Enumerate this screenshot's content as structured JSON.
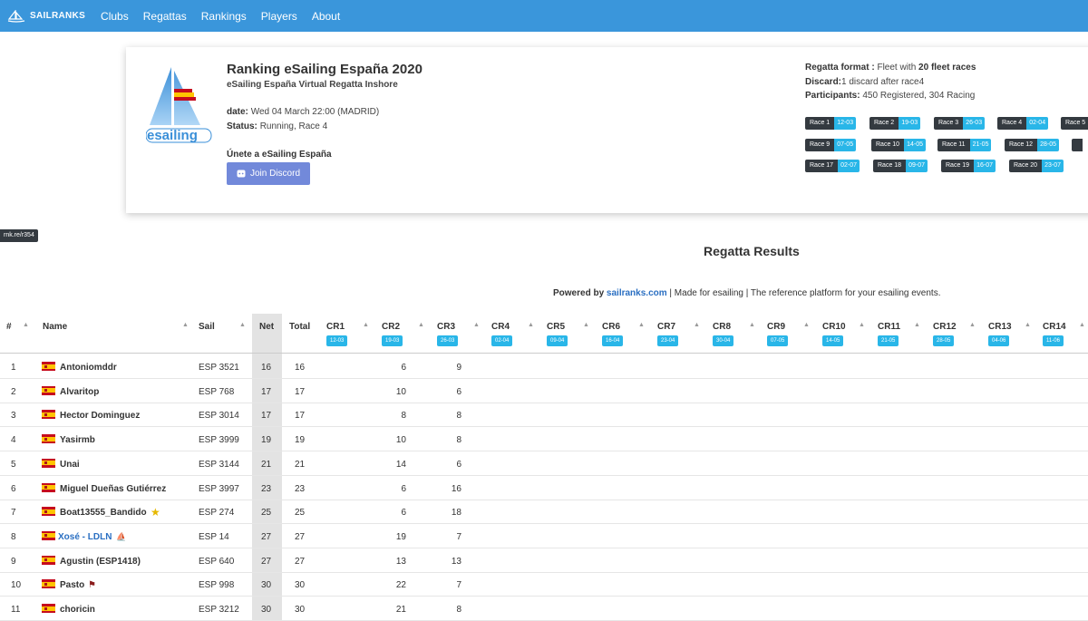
{
  "nav": {
    "brand": "SAILRANKS",
    "items": [
      "Clubs",
      "Regattas",
      "Rankings",
      "Players",
      "About"
    ]
  },
  "regatta": {
    "title": "Ranking eSailing España 2020",
    "subtitle": "eSailing España Virtual Regatta Inshore",
    "date_label": "date:",
    "date_value": "Wed 04 March 22:00 (MADRID)",
    "status_label": "Status:",
    "status_value": "Running, Race 4",
    "join_label": "Únete a eSailing España",
    "join_button": "Join Discord",
    "logo_text": "esailing"
  },
  "format": {
    "format_label": "Regatta format :",
    "format_value_pre": "Fleet with",
    "format_value_num": "20 fleet races",
    "discard_label": "Discard:",
    "discard_value": "1 discard after race4",
    "participants_label": "Participants:",
    "participants_value": "450 Registered, 304 Racing"
  },
  "races": [
    {
      "name": "Race 1",
      "date": "12-03"
    },
    {
      "name": "Race 2",
      "date": "19-03"
    },
    {
      "name": "Race 3",
      "date": "26-03"
    },
    {
      "name": "Race 4",
      "date": "02-04"
    },
    {
      "name": "Race 5",
      "date": ""
    },
    {
      "name": "Race 9",
      "date": "07-05"
    },
    {
      "name": "Race 10",
      "date": "14-05"
    },
    {
      "name": "Race 11",
      "date": "21-05"
    },
    {
      "name": "Race 12",
      "date": "28-05"
    },
    {
      "name": "Race 17",
      "date": "02-07"
    },
    {
      "name": "Race 18",
      "date": "09-07"
    },
    {
      "name": "Race 19",
      "date": "16-07"
    },
    {
      "name": "Race 20",
      "date": "23-07"
    }
  ],
  "shortlink": "rnk.re/r354",
  "results_title": "Regatta Results",
  "powered": {
    "prefix": "Powered by",
    "link": "sailranks.com",
    "suffix": "| Made for esailing | The reference platform for your esailing events."
  },
  "table": {
    "headers": {
      "rank": "#",
      "name": "Name",
      "sail": "Sail",
      "net": "Net",
      "total": "Total"
    },
    "race_cols": [
      {
        "label": "CR1",
        "date": "12-03"
      },
      {
        "label": "CR2",
        "date": "19-03"
      },
      {
        "label": "CR3",
        "date": "26-03"
      },
      {
        "label": "CR4",
        "date": "02-04"
      },
      {
        "label": "CR5",
        "date": "09-04"
      },
      {
        "label": "CR6",
        "date": "16-04"
      },
      {
        "label": "CR7",
        "date": "23-04"
      },
      {
        "label": "CR8",
        "date": "30-04"
      },
      {
        "label": "CR9",
        "date": "07-05"
      },
      {
        "label": "CR10",
        "date": "14-05"
      },
      {
        "label": "CR11",
        "date": "21-05"
      },
      {
        "label": "CR12",
        "date": "28-05"
      },
      {
        "label": "CR13",
        "date": "04-06"
      },
      {
        "label": "CR14",
        "date": "11-06"
      }
    ],
    "rows": [
      {
        "rank": "1",
        "name": "Antoniomddr",
        "sail": "ESP 3521",
        "net": "16",
        "total": "16",
        "cr2": "6",
        "cr3": "9",
        "link": false,
        "suffix": ""
      },
      {
        "rank": "2",
        "name": "Alvaritop",
        "sail": "ESP 768",
        "net": "17",
        "total": "17",
        "cr2": "10",
        "cr3": "6",
        "link": false,
        "suffix": ""
      },
      {
        "rank": "3",
        "name": "Hector Dominguez",
        "sail": "ESP 3014",
        "net": "17",
        "total": "17",
        "cr2": "8",
        "cr3": "8",
        "link": false,
        "suffix": ""
      },
      {
        "rank": "4",
        "name": "Yasirmb",
        "sail": "ESP 3999",
        "net": "19",
        "total": "19",
        "cr2": "10",
        "cr3": "8",
        "link": false,
        "suffix": ""
      },
      {
        "rank": "5",
        "name": "Unai",
        "sail": "ESP 3144",
        "net": "21",
        "total": "21",
        "cr2": "14",
        "cr3": "6",
        "link": false,
        "suffix": ""
      },
      {
        "rank": "6",
        "name": "Miguel Dueñas Gutiérrez",
        "sail": "ESP 3997",
        "net": "23",
        "total": "23",
        "cr2": "6",
        "cr3": "16",
        "link": false,
        "suffix": ""
      },
      {
        "rank": "7",
        "name": "Boat13555_Bandido",
        "sail": "ESP 274",
        "net": "25",
        "total": "25",
        "cr2": "6",
        "cr3": "18",
        "link": false,
        "suffix": "star"
      },
      {
        "rank": "8",
        "name": "Xosé - LDLN",
        "sail": "ESP 14",
        "net": "27",
        "total": "27",
        "cr2": "19",
        "cr3": "7",
        "link": true,
        "suffix": "boat"
      },
      {
        "rank": "9",
        "name": "Agustin (ESP1418)",
        "sail": "ESP 640",
        "net": "27",
        "total": "27",
        "cr2": "13",
        "cr3": "13",
        "link": false,
        "suffix": ""
      },
      {
        "rank": "10",
        "name": "Pasto",
        "sail": "ESP 998",
        "net": "30",
        "total": "30",
        "cr2": "22",
        "cr3": "7",
        "link": false,
        "suffix": "flag"
      },
      {
        "rank": "11",
        "name": "choricin",
        "sail": "ESP 3212",
        "net": "30",
        "total": "30",
        "cr2": "21",
        "cr3": "8",
        "link": false,
        "suffix": ""
      }
    ]
  },
  "colors": {
    "navbar": "#3a96db",
    "discord": "#7289da",
    "badge_dark": "#343a40",
    "badge_cyan": "#29b6e8",
    "link": "#2a6fc2"
  }
}
